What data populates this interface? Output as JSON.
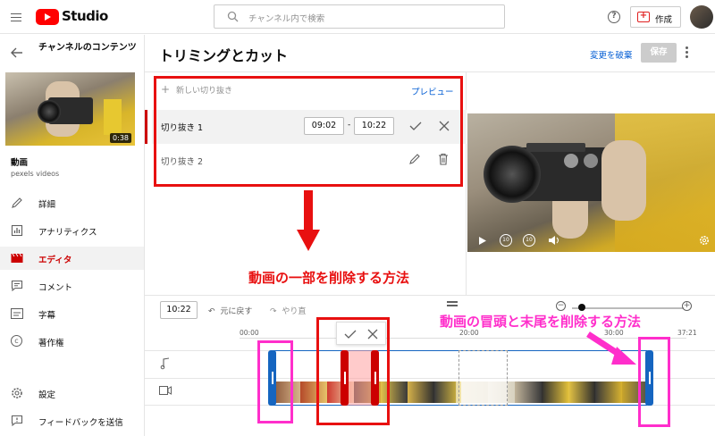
{
  "header": {
    "app_name": "Studio",
    "search_placeholder": "チャンネル内で検索",
    "help_label": "?",
    "create_label": "作成"
  },
  "sidebar": {
    "back_title": "チャンネルのコンテンツ",
    "video_duration": "0:38",
    "video_title": "動画",
    "video_channel": "pexels videos",
    "items": [
      {
        "label": "詳細",
        "icon": "pencil-icon"
      },
      {
        "label": "アナリティクス",
        "icon": "analytics-icon"
      },
      {
        "label": "エディタ",
        "icon": "editor-icon"
      },
      {
        "label": "コメント",
        "icon": "comment-icon"
      },
      {
        "label": "字幕",
        "icon": "subtitles-icon"
      },
      {
        "label": "著作権",
        "icon": "copyright-icon"
      }
    ],
    "bottom_items": [
      {
        "label": "設定",
        "icon": "gear-icon"
      },
      {
        "label": "フィードバックを送信",
        "icon": "feedback-icon"
      }
    ]
  },
  "editor": {
    "title": "トリミングとカット",
    "discard_label": "変更を破棄",
    "save_label": "保存",
    "new_clip_label": "新しい切り抜き",
    "preview_label": "プレビュー",
    "clips": [
      {
        "label": "切り抜き 1",
        "start": "09:02",
        "separator": "-",
        "end": "10:22"
      },
      {
        "label": "切り抜き 2"
      }
    ]
  },
  "timeline": {
    "current_time": "10:22",
    "undo_label": "元に戻す",
    "redo_label": "やり直",
    "ticks": [
      "00:00",
      "20:00",
      "30:00",
      "37:21"
    ]
  },
  "annotations": {
    "cut_middle": "動画の一部を削除する方法",
    "trim_ends": "動画の冒頭と末尾を削除する方法"
  },
  "colors": {
    "brand_red": "#ff0000",
    "annotation_red": "#e81010",
    "annotation_pink": "#ff2ecb",
    "link_blue": "#065fd4",
    "trim_blue": "#1565c0"
  }
}
